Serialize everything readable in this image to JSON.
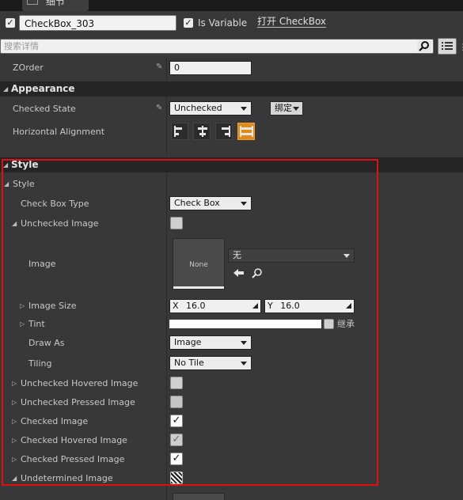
{
  "tab": {
    "title": "细节"
  },
  "header": {
    "widget_name": "CheckBox_303",
    "is_variable_label": "Is Variable",
    "open_link": "打开 CheckBox"
  },
  "search": {
    "placeholder": "搜索详情"
  },
  "zorder": {
    "label": "ZOrder",
    "value": "0"
  },
  "appearance": {
    "title": "Appearance",
    "checked_state_label": "Checked State",
    "checked_state_value": "Unchecked",
    "bind_button": "绑定",
    "horizontal_alignment_label": "Horizontal Alignment"
  },
  "style_section": {
    "title": "Style",
    "style_group": "Style",
    "check_box_type_label": "Check Box Type",
    "check_box_type_value": "Check Box",
    "unchecked_image_label": "Unchecked Image",
    "image_label": "Image",
    "thumb_none": "None",
    "image_asset_value": "无",
    "image_size_label": "Image Size",
    "size_x_label": "X",
    "size_x_value": "16.0",
    "size_y_label": "Y",
    "size_y_value": "16.0",
    "tint_label": "Tint",
    "inherit_label": "继承",
    "draw_as_label": "Draw As",
    "draw_as_value": "Image",
    "tiling_label": "Tiling",
    "tiling_value": "No Tile",
    "unchecked_hovered_label": "Unchecked Hovered Image",
    "unchecked_pressed_label": "Unchecked Pressed Image",
    "checked_image_label": "Checked Image",
    "checked_hovered_label": "Checked Hovered Image",
    "checked_pressed_label": "Checked Pressed Image",
    "undetermined_label": "Undetermined Image"
  },
  "colors": {
    "accent": "#e08a18",
    "highlight_frame": "#e01010"
  }
}
